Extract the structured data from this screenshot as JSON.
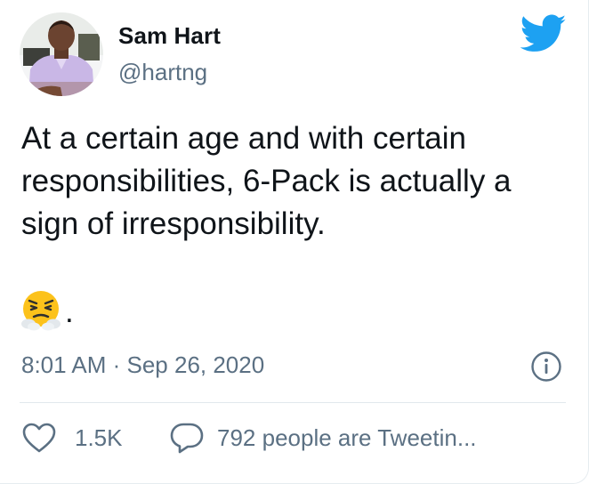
{
  "author": {
    "name": "Sam Hart",
    "handle": "@hartng",
    "avatar_icon": "profile-photo"
  },
  "brand": {
    "logo_icon": "twitter-bird-icon",
    "color": "#1da1f2"
  },
  "tweet": {
    "text": "At a certain age and with certain responsibilities, 6-Pack is actually a sign of irresponsibility.",
    "emoji_icon": "face-with-steam-from-nose-emoji",
    "emoji_suffix": ".",
    "timestamp": "8:01 AM · Sep 26, 2020"
  },
  "actions": {
    "like_icon": "heart-icon",
    "like_count": "1.5K",
    "reply_icon": "speech-bubble-icon",
    "reply_label": "792 people are Tweetin..."
  },
  "colors": {
    "text": "#0f1419",
    "secondary_text": "#5b7083",
    "divider": "#e1e8ed"
  }
}
